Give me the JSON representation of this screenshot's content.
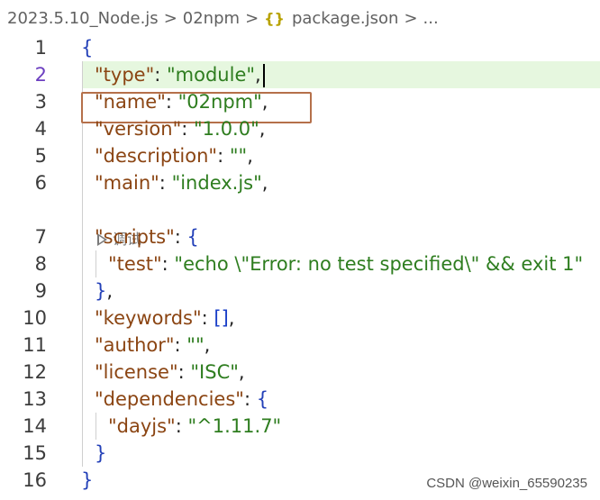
{
  "breadcrumb": {
    "items": [
      "2023.5.10_Node.js",
      "02npm",
      "package.json",
      "..."
    ],
    "separator": ">",
    "json_icon": "{}"
  },
  "editor": {
    "active_line": 2,
    "codelens_label": "调试",
    "lines": [
      {
        "n": "1",
        "tokens": [
          {
            "t": "brace",
            "v": "{"
          }
        ]
      },
      {
        "n": "2",
        "tokens": [
          {
            "t": "key",
            "v": "\"type\""
          },
          {
            "t": "punc",
            "v": ": "
          },
          {
            "t": "str",
            "v": "\"module\""
          },
          {
            "t": "punc",
            "v": ","
          }
        ]
      },
      {
        "n": "3",
        "tokens": [
          {
            "t": "key",
            "v": "\"name\""
          },
          {
            "t": "punc",
            "v": ": "
          },
          {
            "t": "str",
            "v": "\"02npm\""
          },
          {
            "t": "punc",
            "v": ","
          }
        ]
      },
      {
        "n": "4",
        "tokens": [
          {
            "t": "key",
            "v": "\"version\""
          },
          {
            "t": "punc",
            "v": ": "
          },
          {
            "t": "str",
            "v": "\"1.0.0\""
          },
          {
            "t": "punc",
            "v": ","
          }
        ]
      },
      {
        "n": "5",
        "tokens": [
          {
            "t": "key",
            "v": "\"description\""
          },
          {
            "t": "punc",
            "v": ": "
          },
          {
            "t": "str",
            "v": "\"\""
          },
          {
            "t": "punc",
            "v": ","
          }
        ]
      },
      {
        "n": "6",
        "tokens": [
          {
            "t": "key",
            "v": "\"main\""
          },
          {
            "t": "punc",
            "v": ": "
          },
          {
            "t": "str",
            "v": "\"index.js\""
          },
          {
            "t": "punc",
            "v": ","
          }
        ]
      },
      {
        "n": "7",
        "tokens": [
          {
            "t": "key",
            "v": "\"scripts\""
          },
          {
            "t": "punc",
            "v": ": "
          },
          {
            "t": "brace",
            "v": "{"
          }
        ]
      },
      {
        "n": "8",
        "tokens": [
          {
            "t": "key",
            "v": "\"test\""
          },
          {
            "t": "punc",
            "v": ": "
          },
          {
            "t": "str",
            "v": "\"echo \\\"Error: no test specified\\\" && exit 1\""
          }
        ]
      },
      {
        "n": "9",
        "tokens": [
          {
            "t": "brace",
            "v": "}"
          },
          {
            "t": "punc",
            "v": ","
          }
        ]
      },
      {
        "n": "10",
        "tokens": [
          {
            "t": "key",
            "v": "\"keywords\""
          },
          {
            "t": "punc",
            "v": ": "
          },
          {
            "t": "bracket",
            "v": "[]"
          },
          {
            "t": "punc",
            "v": ","
          }
        ]
      },
      {
        "n": "11",
        "tokens": [
          {
            "t": "key",
            "v": "\"author\""
          },
          {
            "t": "punc",
            "v": ": "
          },
          {
            "t": "str",
            "v": "\"\""
          },
          {
            "t": "punc",
            "v": ","
          }
        ]
      },
      {
        "n": "12",
        "tokens": [
          {
            "t": "key",
            "v": "\"license\""
          },
          {
            "t": "punc",
            "v": ": "
          },
          {
            "t": "str",
            "v": "\"ISC\""
          },
          {
            "t": "punc",
            "v": ","
          }
        ]
      },
      {
        "n": "13",
        "tokens": [
          {
            "t": "key",
            "v": "\"dependencies\""
          },
          {
            "t": "punc",
            "v": ": "
          },
          {
            "t": "brace",
            "v": "{"
          }
        ]
      },
      {
        "n": "14",
        "tokens": [
          {
            "t": "key",
            "v": "\"dayjs\""
          },
          {
            "t": "punc",
            "v": ": "
          },
          {
            "t": "str",
            "v": "\"^1.11.7\""
          }
        ]
      },
      {
        "n": "15",
        "tokens": [
          {
            "t": "brace",
            "v": "}"
          }
        ]
      },
      {
        "n": "16",
        "tokens": [
          {
            "t": "brace",
            "v": "}"
          }
        ]
      }
    ]
  },
  "watermark": "CSDN @weixin_65590235",
  "colors": {
    "key": "#8b4513",
    "string": "#2e7d1f",
    "brace": "#2340b8",
    "active_line_bg": "#e6f7df",
    "highlight_border": "#b5704a"
  }
}
